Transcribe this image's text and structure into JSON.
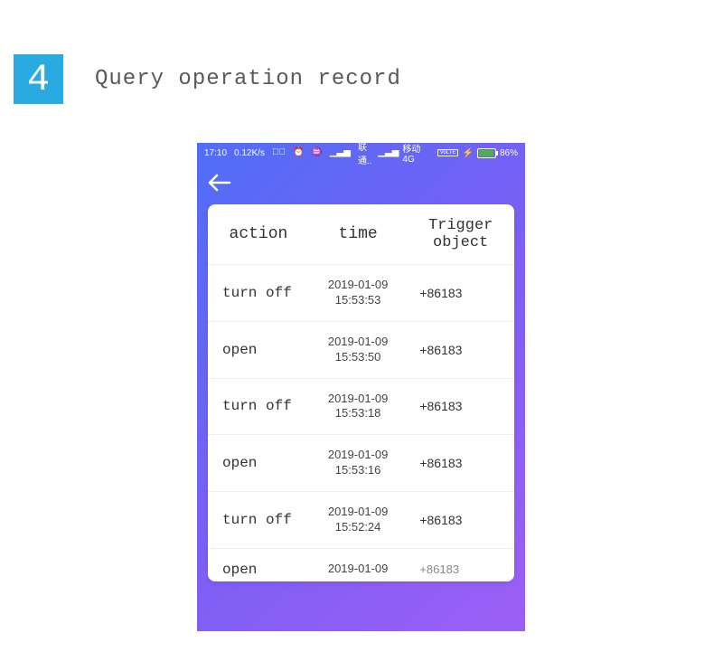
{
  "step": {
    "number": "4",
    "title": "Query operation record"
  },
  "statusbar": {
    "time": "17:10",
    "speed": "0.12K/s",
    "carrier1": "联通..",
    "carrier2": "移动 4G",
    "volte": "VoLTE",
    "bolt": "⚡",
    "battery": "86%"
  },
  "table": {
    "headers": {
      "action": "action",
      "time": "time",
      "trigger": "Trigger object"
    },
    "rows": [
      {
        "action": "turn off",
        "date": "2019-01-09",
        "time": "15:53:53",
        "trigger": "+86183"
      },
      {
        "action": "open",
        "date": "2019-01-09",
        "time": "15:53:50",
        "trigger": "+86183"
      },
      {
        "action": "turn off",
        "date": "2019-01-09",
        "time": "15:53:18",
        "trigger": "+86183"
      },
      {
        "action": "open",
        "date": "2019-01-09",
        "time": "15:53:16",
        "trigger": "+86183"
      },
      {
        "action": "turn off",
        "date": "2019-01-09",
        "time": "15:52:24",
        "trigger": "+86183"
      },
      {
        "action": "open",
        "date": "2019-01-09",
        "time": "",
        "trigger": "+86183"
      }
    ]
  }
}
